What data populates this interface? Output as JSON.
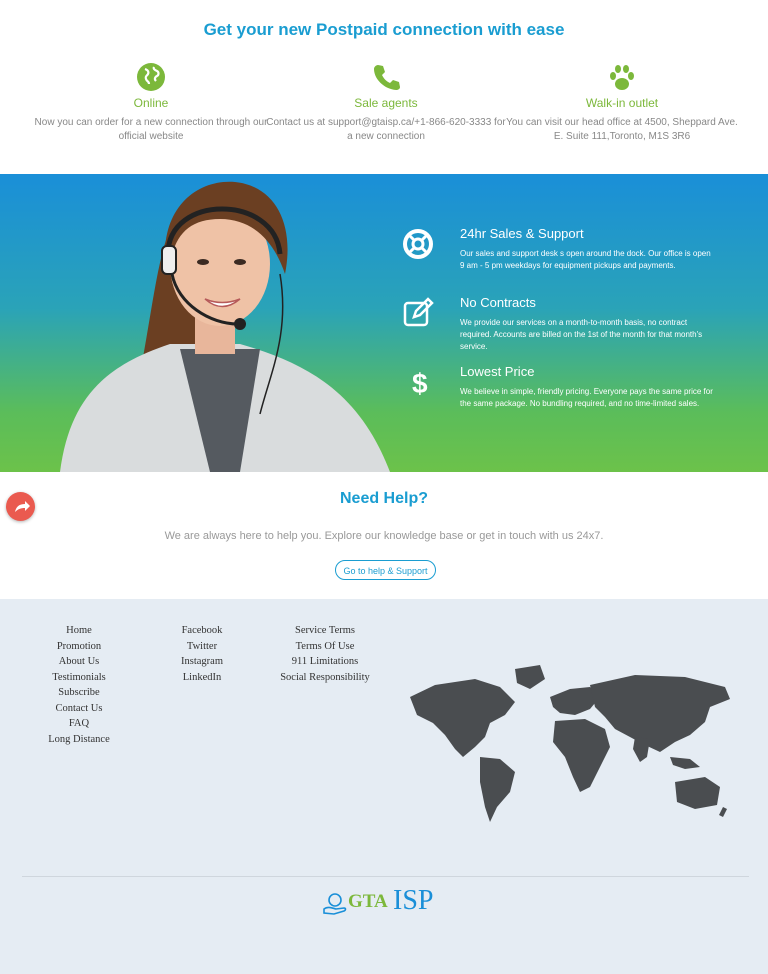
{
  "top": {
    "title": "Get your new Postpaid connection with ease",
    "columns": [
      {
        "icon": "globe-icon",
        "title": "Online",
        "desc": "Now you can order for a new connection through our official website"
      },
      {
        "icon": "phone-icon",
        "title": "Sale agents",
        "desc": "Contact us at support@gtaisp.ca/+1-866-620-3333 for a new connection"
      },
      {
        "icon": "paw-icon",
        "title": "Walk-in outlet",
        "desc": "You can visit our head office at 4500, Sheppard Ave. E. Suite 111,Toronto, M1S 3R6"
      }
    ],
    "accent": "#1a9dd1",
    "green": "#7cb83b"
  },
  "features": [
    {
      "icon": "lifebuoy-icon",
      "title": "24hr Sales & Support",
      "desc": "Our sales and support desk s open around the dock. Our office is open 9 am - 5 pm weekdays for equipment pickups and payments."
    },
    {
      "icon": "edit-icon",
      "title": "No Contracts",
      "desc": "We provide our services on a month-to-month basis, no contract required. Accounts are billed on the 1st of the month for that month's service."
    },
    {
      "icon": "dollar-icon",
      "title": "Lowest Price",
      "desc": "We believe in simple, friendly pricing. Everyone pays the same price for the same package. No bundling required, and no time-limited sales."
    }
  ],
  "help": {
    "title": "Need Help?",
    "desc": "We are always here to help you. Explore our knowledge base or get in touch with us 24x7.",
    "button": "Go to help & Support"
  },
  "footer": {
    "col1": [
      "Home",
      "Promotion",
      "About Us",
      "Testimonials",
      "Subscribe",
      "Contact Us",
      "FAQ",
      "Long Distance"
    ],
    "col2": [
      "Facebook",
      "Twitter",
      "Instagram",
      "LinkedIn"
    ],
    "col3": [
      "Service Terms",
      "Terms Of Use",
      "911 Limitations",
      "Social Responsibility"
    ],
    "logo_left": "GTA",
    "logo_right": "ISP"
  }
}
